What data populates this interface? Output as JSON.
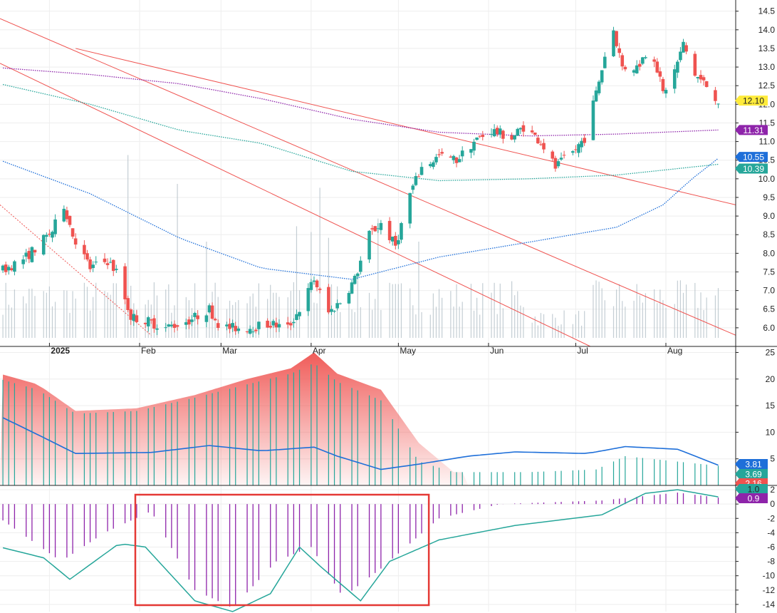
{
  "chart_data": [
    {
      "panel": "price",
      "type": "candlestick",
      "title": "",
      "x_axis": {
        "type": "date",
        "tick_labels": [
          "2025",
          "Feb",
          "Mar",
          "Apr",
          "May",
          "Jun",
          "Jul",
          "Aug"
        ],
        "range": [
          "2024-12-15",
          "2025-08-25"
        ]
      },
      "y_axis": {
        "side": "right",
        "ylim": [
          5.5,
          14.8
        ],
        "tick_labels": [
          "6.0",
          "6.5",
          "7.0",
          "7.5",
          "8.0",
          "8.5",
          "9.0",
          "9.5",
          "10.0",
          "10.5",
          "11.0",
          "11.5",
          "12.0",
          "12.5",
          "13.0",
          "13.5",
          "14.0",
          "14.5"
        ]
      },
      "grid": true,
      "colors": {
        "up": "#26a69a",
        "down": "#ef5350",
        "volume": "#b0bec5",
        "trendline": "#ef5350"
      },
      "price_path": [
        [
          "2024-12-15",
          7.5
        ],
        [
          "2024-12-24",
          7.9
        ],
        [
          "2025-01-02",
          8.6
        ],
        [
          "2025-01-06",
          9.3
        ],
        [
          "2025-01-09",
          8.5
        ],
        [
          "2025-01-15",
          7.6
        ],
        [
          "2025-01-21",
          7.8
        ],
        [
          "2025-01-24",
          7.5
        ],
        [
          "2025-01-29",
          6.3
        ],
        [
          "2025-02-03",
          6.2
        ],
        [
          "2025-02-10",
          6.0
        ],
        [
          "2025-02-18",
          6.2
        ],
        [
          "2025-02-25",
          6.5
        ],
        [
          "2025-03-01",
          6.0
        ],
        [
          "2025-03-10",
          6.0
        ],
        [
          "2025-03-18",
          6.1
        ],
        [
          "2025-03-24",
          6.0
        ],
        [
          "2025-03-28",
          6.5
        ],
        [
          "2025-04-02",
          7.3
        ],
        [
          "2025-04-07",
          6.4
        ],
        [
          "2025-04-11",
          6.7
        ],
        [
          "2025-04-16",
          7.3
        ],
        [
          "2025-04-21",
          8.5
        ],
        [
          "2025-04-25",
          8.8
        ],
        [
          "2025-04-30",
          8.2
        ],
        [
          "2025-05-05",
          9.6
        ],
        [
          "2025-05-09",
          10.3
        ],
        [
          "2025-05-15",
          10.6
        ],
        [
          "2025-05-21",
          10.5
        ],
        [
          "2025-05-27",
          11.0
        ],
        [
          "2025-06-02",
          11.3
        ],
        [
          "2025-06-09",
          11.1
        ],
        [
          "2025-06-13",
          11.4
        ],
        [
          "2025-06-19",
          11.0
        ],
        [
          "2025-06-24",
          10.3
        ],
        [
          "2025-06-30",
          10.7
        ],
        [
          "2025-07-04",
          11.1
        ],
        [
          "2025-07-08",
          12.3
        ],
        [
          "2025-07-11",
          13.3
        ],
        [
          "2025-07-14",
          14.0
        ],
        [
          "2025-07-17",
          13.0
        ],
        [
          "2025-07-22",
          13.0
        ],
        [
          "2025-07-27",
          13.6
        ],
        [
          "2025-07-31",
          12.3
        ],
        [
          "2025-08-04",
          12.9
        ],
        [
          "2025-08-07",
          13.6
        ],
        [
          "2025-08-11",
          12.8
        ],
        [
          "2025-08-15",
          12.5
        ],
        [
          "2025-08-19",
          12.1
        ]
      ],
      "series": [
        {
          "label": "11.31",
          "color": "#8e24aa",
          "style": "dotted",
          "values": [
            [
              "2024-12-15",
              12.98
            ],
            [
              "2025-01-15",
              12.8
            ],
            [
              "2025-02-15",
              12.55
            ],
            [
              "2025-03-15",
              12.15
            ],
            [
              "2025-04-15",
              11.6
            ],
            [
              "2025-05-15",
              11.25
            ],
            [
              "2025-06-15",
              11.15
            ],
            [
              "2025-07-15",
              11.2
            ],
            [
              "2025-08-19",
              11.31
            ]
          ]
        },
        {
          "label": "10.39",
          "color": "#26a69a",
          "style": "dotted",
          "values": [
            [
              "2024-12-15",
              12.55
            ],
            [
              "2025-01-15",
              12.0
            ],
            [
              "2025-02-15",
              11.3
            ],
            [
              "2025-03-15",
              10.95
            ],
            [
              "2025-04-15",
              10.2
            ],
            [
              "2025-05-15",
              9.95
            ],
            [
              "2025-06-15",
              10.0
            ],
            [
              "2025-07-15",
              10.1
            ],
            [
              "2025-08-19",
              10.39
            ]
          ]
        },
        {
          "label": "10.55",
          "color": "#1e6fd9",
          "style": "dotted",
          "values": [
            [
              "2024-12-15",
              10.5
            ],
            [
              "2025-01-15",
              9.6
            ],
            [
              "2025-02-15",
              8.4
            ],
            [
              "2025-03-15",
              7.6
            ],
            [
              "2025-04-15",
              7.3
            ],
            [
              "2025-05-15",
              7.9
            ],
            [
              "2025-06-15",
              8.3
            ],
            [
              "2025-07-15",
              8.7
            ],
            [
              "2025-07-31",
              9.3
            ],
            [
              "2025-08-10",
              10.0
            ],
            [
              "2025-08-19",
              10.55
            ]
          ]
        }
      ],
      "trendlines": [
        {
          "from": [
            "2025-01-10",
            13.5
          ],
          "to": [
            "2025-08-25",
            9.3
          ]
        },
        {
          "from": [
            "2024-12-15",
            14.3
          ],
          "to": [
            "2025-08-25",
            5.8
          ]
        },
        {
          "from": [
            "2024-12-15",
            13.1
          ],
          "to": [
            "2025-07-06",
            5.5
          ]
        }
      ],
      "price_label": {
        "label": "12.10",
        "value": 12.1,
        "color": "#ffeb3b"
      },
      "volume": "bars along the lower part of the price pane, tallest in mid-Feb and early April"
    },
    {
      "panel": "indicator-1",
      "type": "area",
      "y_axis": {
        "side": "right",
        "ylim": [
          0,
          26
        ],
        "tick_labels": [
          "5",
          "10",
          "15",
          "20",
          "25"
        ]
      },
      "colors": {
        "area": "#ef5350",
        "bars": "#26a69a",
        "line": "#1e6fd9"
      },
      "series": [
        {
          "label": "2.16",
          "color": "#ef5350",
          "type": "area",
          "values": [
            [
              "2024-12-15",
              21
            ],
            [
              "2024-12-28",
              19
            ],
            [
              "2025-01-10",
              14
            ],
            [
              "2025-01-31",
              14.5
            ],
            [
              "2025-02-20",
              17
            ],
            [
              "2025-03-10",
              20
            ],
            [
              "2025-03-25",
              22
            ],
            [
              "2025-04-02",
              25
            ],
            [
              "2025-04-10",
              21
            ],
            [
              "2025-04-25",
              18
            ],
            [
              "2025-05-08",
              8
            ],
            [
              "2025-05-20",
              2.5
            ],
            [
              "2025-08-19",
              2.16
            ]
          ]
        },
        {
          "label": "3.69",
          "color": "#26a69a",
          "type": "bar",
          "values": [
            [
              "2024-12-15",
              20
            ],
            [
              "2024-12-28",
              18
            ],
            [
              "2025-01-10",
              13.5
            ],
            [
              "2025-01-31",
              14
            ],
            [
              "2025-02-20",
              16.5
            ],
            [
              "2025-03-10",
              19
            ],
            [
              "2025-03-25",
              21
            ],
            [
              "2025-04-02",
              23
            ],
            [
              "2025-04-10",
              19.5
            ],
            [
              "2025-04-25",
              16
            ],
            [
              "2025-05-08",
              4.5
            ],
            [
              "2025-05-20",
              2.5
            ],
            [
              "2025-06-15",
              2.5
            ],
            [
              "2025-07-08",
              3
            ],
            [
              "2025-07-18",
              5.5
            ],
            [
              "2025-08-19",
              3.69
            ]
          ]
        },
        {
          "label": "3.81",
          "color": "#1e6fd9",
          "type": "line",
          "values": [
            [
              "2024-12-15",
              13
            ],
            [
              "2024-12-30",
              9
            ],
            [
              "2025-01-10",
              6
            ],
            [
              "2025-02-05",
              6.2
            ],
            [
              "2025-02-25",
              7.5
            ],
            [
              "2025-03-15",
              6.5
            ],
            [
              "2025-04-02",
              7.2
            ],
            [
              "2025-04-10",
              5.5
            ],
            [
              "2025-04-25",
              3
            ],
            [
              "2025-05-08",
              4
            ],
            [
              "2025-05-25",
              5.5
            ],
            [
              "2025-06-10",
              6.3
            ],
            [
              "2025-07-05",
              6
            ],
            [
              "2025-07-18",
              7.3
            ],
            [
              "2025-08-05",
              6.8
            ],
            [
              "2025-08-19",
              3.81
            ]
          ]
        }
      ]
    },
    {
      "panel": "indicator-2",
      "type": "bar",
      "y_axis": {
        "side": "right",
        "ylim": [
          -15,
          2.5
        ],
        "tick_labels": [
          "2",
          "0",
          "-2",
          "-4",
          "-6",
          "-8",
          "-10",
          "-12",
          "-14"
        ]
      },
      "colors": {
        "bars": "#8e24aa",
        "line": "#26a69a",
        "highlight": "#e53935"
      },
      "series": [
        {
          "label": "0.9",
          "color": "#8e24aa",
          "type": "bar",
          "values": [
            [
              "2024-12-15",
              -2
            ],
            [
              "2025-01-05",
              -8
            ],
            [
              "2025-01-20",
              -4
            ],
            [
              "2025-02-05",
              -1
            ],
            [
              "2025-02-20",
              -12
            ],
            [
              "2025-03-05",
              -14.5
            ],
            [
              "2025-03-20",
              -8
            ],
            [
              "2025-04-01",
              -6
            ],
            [
              "2025-04-12",
              -13
            ],
            [
              "2025-04-25",
              -9
            ],
            [
              "2025-05-15",
              -2
            ],
            [
              "2025-06-05",
              0
            ],
            [
              "2025-07-10",
              0.5
            ],
            [
              "2025-08-05",
              1.6
            ],
            [
              "2025-08-19",
              0.9
            ]
          ]
        },
        {
          "label": "1.0",
          "color": "#26a69a",
          "type": "line",
          "values": [
            [
              "2024-12-15",
              -6
            ],
            [
              "2024-12-30",
              -7.5
            ],
            [
              "2025-01-08",
              -10.5
            ],
            [
              "2025-01-25",
              -5.5
            ],
            [
              "2025-02-03",
              -6
            ],
            [
              "2025-02-20",
              -13.5
            ],
            [
              "2025-03-05",
              -15
            ],
            [
              "2025-03-18",
              -12.5
            ],
            [
              "2025-03-28",
              -6
            ],
            [
              "2025-04-05",
              -9
            ],
            [
              "2025-04-18",
              -13.5
            ],
            [
              "2025-04-28",
              -8
            ],
            [
              "2025-05-15",
              -5
            ],
            [
              "2025-06-10",
              -3
            ],
            [
              "2025-07-10",
              -1.5
            ],
            [
              "2025-07-25",
              1.5
            ],
            [
              "2025-08-05",
              2
            ],
            [
              "2025-08-19",
              1
            ]
          ]
        }
      ],
      "highlight_box": {
        "from": "2025-02-01",
        "to": "2025-05-10"
      }
    }
  ]
}
